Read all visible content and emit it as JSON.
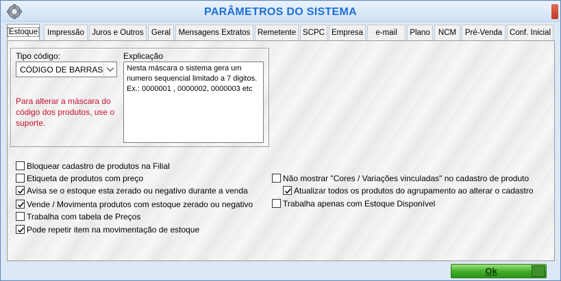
{
  "window": {
    "title": "PARÂMETROS DO SISTEMA",
    "icon": "gear-icon"
  },
  "tabs": [
    {
      "label": "Estoque",
      "active": true
    },
    {
      "label": "Impressão"
    },
    {
      "label": "Juros e Outros"
    },
    {
      "label": "Geral"
    },
    {
      "label": "Mensagens Extratos"
    },
    {
      "label": "Remetente"
    },
    {
      "label": "SCPC"
    },
    {
      "label": "Empresa"
    },
    {
      "label": "e-mail"
    },
    {
      "label": "Plano"
    },
    {
      "label": "NCM"
    },
    {
      "label": "Pré-Venda"
    },
    {
      "label": "Conf. Inicial"
    }
  ],
  "estoque": {
    "tipo_codigo_label": "Tipo código:",
    "tipo_codigo_value": "CÓDIGO DE BARRAS",
    "explicacao_label": "Explicação",
    "explicacao_text": "Nesta máscara o sistema gera um numero sequencial limitado a 7 digitos.\nEx.: 0000001 , 0000002, 0000003 etc",
    "mask_note": "Para alterar a máscara do código dos produtos, use o suporte.",
    "options_left": [
      {
        "label": "Bloquear cadastro de produtos na Filial",
        "checked": false
      },
      {
        "label": "Etiqueta de produtos com preço",
        "checked": false
      },
      {
        "label": "Avisa se o estoque esta zerado ou negativo durante a venda",
        "checked": true
      },
      {
        "label": "Vende / Movimenta produtos com estoque zerado ou negativo",
        "checked": true
      },
      {
        "label": "Trabalha com tabela de Preços",
        "checked": false
      },
      {
        "label": "Pode repetir item na movimentação de estoque",
        "checked": true
      }
    ],
    "options_right": [
      {
        "label": "Não mostrar \"Cores / Variações vinculadas\" no cadastro de produto",
        "checked": false
      },
      {
        "label": "Atualizar todos os produtos do agrupamento ao alterar o cadastro",
        "checked": true
      },
      {
        "label": "Trabalha apenas com Estoque Disponível",
        "checked": false
      }
    ]
  },
  "footer": {
    "ok_label": "Ok"
  },
  "colors": {
    "title": "#1d6fd6",
    "note_red": "#c8102e",
    "ok_green": "#3faa28"
  }
}
